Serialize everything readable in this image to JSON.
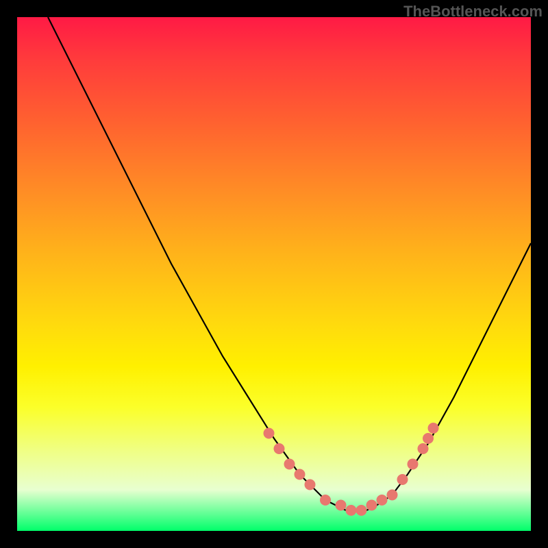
{
  "watermark": "TheBottleneck.com",
  "chart_data": {
    "type": "line",
    "title": "",
    "xlabel": "",
    "ylabel": "",
    "xlim": [
      0,
      100
    ],
    "ylim": [
      0,
      100
    ],
    "series": [
      {
        "name": "curve",
        "x": [
          6,
          10,
          15,
          20,
          25,
          30,
          35,
          40,
          45,
          50,
          55,
          58,
          60,
          62,
          64,
          66,
          68,
          70,
          73,
          76,
          80,
          85,
          90,
          95,
          100
        ],
        "y": [
          100,
          92,
          82,
          72,
          62,
          52,
          43,
          34,
          26,
          18,
          11,
          8,
          6,
          5,
          4,
          4,
          4,
          5,
          7,
          11,
          17,
          26,
          36,
          46,
          56
        ]
      }
    ],
    "markers": {
      "name": "highlighted-points",
      "color": "#e8786f",
      "x": [
        49,
        51,
        53,
        55,
        57,
        60,
        63,
        65,
        67,
        69,
        71,
        73,
        75,
        77,
        79,
        80,
        81
      ],
      "y": [
        19,
        16,
        13,
        11,
        9,
        6,
        5,
        4,
        4,
        5,
        6,
        7,
        10,
        13,
        16,
        18,
        20
      ]
    }
  }
}
